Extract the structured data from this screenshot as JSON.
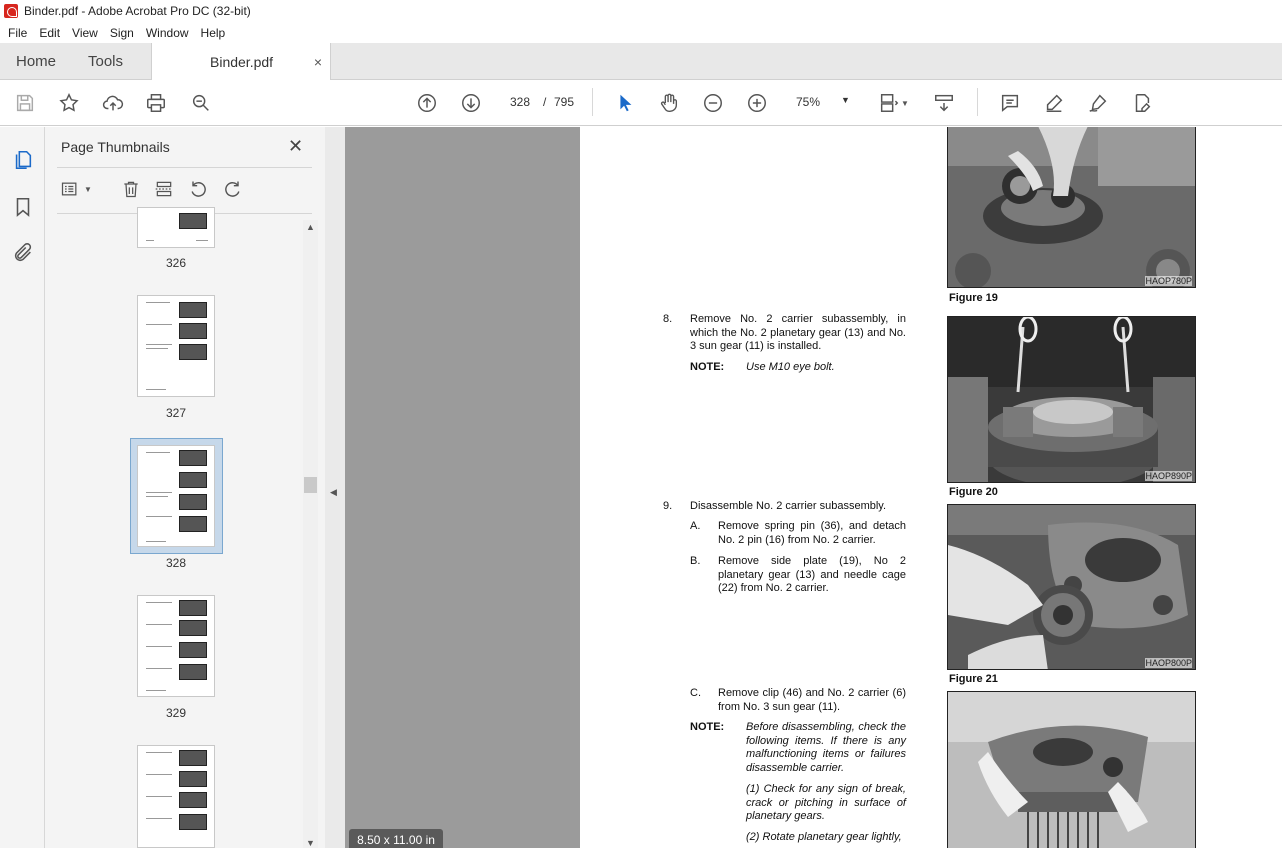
{
  "window": {
    "title": "Binder.pdf - Adobe Acrobat Pro DC (32-bit)"
  },
  "menu": [
    "File",
    "Edit",
    "View",
    "Sign",
    "Window",
    "Help"
  ],
  "tabs": {
    "home": "Home",
    "tools": "Tools",
    "document": "Binder.pdf",
    "close": "×"
  },
  "toolbar": {
    "current_page": "328",
    "separator": "/",
    "total_pages": "795",
    "zoom": "75%"
  },
  "thumbnails": {
    "panel_title": "Page Thumbnails",
    "close": "✕",
    "pages": [
      {
        "label": "326"
      },
      {
        "label": "327"
      },
      {
        "label": "328",
        "selected": true
      },
      {
        "label": "329"
      },
      {
        "label": "330"
      }
    ]
  },
  "status": {
    "page_size": "8.50 x 11.00 in"
  },
  "document": {
    "figures": [
      {
        "caption": "Figure 19",
        "code": "HAOP780P"
      },
      {
        "caption": "Figure 20",
        "code": "HAOP890P"
      },
      {
        "caption": "Figure 21",
        "code": "HAOP800P"
      },
      {
        "caption": "",
        "code": ""
      }
    ],
    "step8": {
      "num": "8.",
      "text": "Remove No. 2 carrier subassembly, in which the No. 2 planetary gear (13) and No. 3 sun gear (11) is installed.",
      "note_label": "NOTE:",
      "note_text": "Use M10 eye bolt."
    },
    "step9": {
      "num": "9.",
      "text": "Disassemble No. 2 carrier subassembly.",
      "a_label": "A.",
      "a_text": "Remove spring pin (36), and detach No. 2 pin (16) from No. 2 carrier.",
      "b_label": "B.",
      "b_text": "Remove side plate (19), No 2 planetary gear (13) and needle cage (22) from No. 2 carrier.",
      "c_label": "C.",
      "c_text": "Remove clip (46) and No. 2 carrier (6) from No. 3 sun gear (11).",
      "note_label": "NOTE:",
      "note_text": "Before disassembling, check the following items. If there is any malfunctioning items or failures disassemble carrier.",
      "note_1": "(1) Check for any sign of break, crack or pitching in surface of planetary gears.",
      "note_2": "(2) Rotate planetary gear lightly,"
    }
  }
}
